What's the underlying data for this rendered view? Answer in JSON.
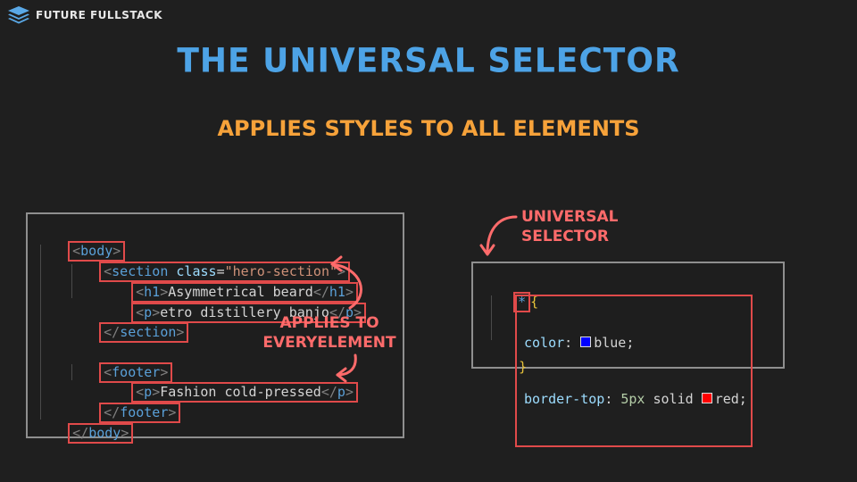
{
  "brand": {
    "name": "FUTURE FULLSTACK",
    "logo_icon": "stacked-layers-icon"
  },
  "title": "THE UNIVERSAL SELECTOR",
  "subtitle": "APPLIES STYLES TO ALL ELEMENTS",
  "html_code": {
    "body_open": "body",
    "section_open": "section",
    "section_attr": "class",
    "section_value": "\"hero-section\"",
    "h1_tag": "h1",
    "h1_text": "Asymmetrical beard",
    "p1_tag": "p",
    "p1_text": "etro distillery banjo",
    "section_close": "section",
    "footer_open": "footer",
    "p2_tag": "p",
    "p2_text": "Fashion cold-pressed",
    "footer_close": "footer",
    "body_close": "body"
  },
  "annotation_left": {
    "line1": "APPLIES TO",
    "line2": "EVERYELEMENT"
  },
  "annotation_right": "UNIVERSAL SELECTOR",
  "css_code": {
    "selector": "*",
    "open_brace": "{",
    "prop1": "color",
    "val1": "blue",
    "prop2": "border-top",
    "val2_num": "5px",
    "val2_style": "solid",
    "val2_color": "red",
    "close_brace": "}"
  },
  "colors": {
    "accent_blue": "#4da3e6",
    "accent_orange": "#f6a23a",
    "highlight_red": "#e04a4a",
    "swatch_blue": "#0000ff",
    "swatch_red": "#ff0000"
  }
}
